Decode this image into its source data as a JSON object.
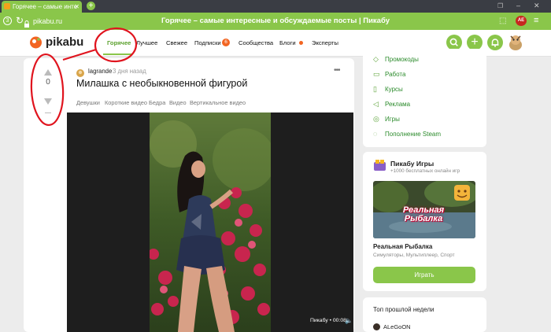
{
  "browser": {
    "tab_title": "Горячее – самые инте",
    "url": "pikabu.ru",
    "window_title": "Горячее – самые интересные и обсуждаемые посты | Пикабу",
    "account_badge": "AE"
  },
  "header": {
    "logo_text": "pikabu",
    "nav": [
      {
        "label": "Горячее"
      },
      {
        "label": "Лучшее"
      },
      {
        "label": "Свежее"
      },
      {
        "label": "Подписки"
      },
      {
        "label": "Сообщества"
      },
      {
        "label": "Блоги"
      },
      {
        "label": "Эксперты"
      }
    ],
    "subscriptions_count": "6"
  },
  "post": {
    "rating": "0",
    "author": "lagrande",
    "time": "3 дня назад",
    "title": "Милашка с необыкновенной фигурой",
    "tags": [
      "Девушки",
      "Короткие видео",
      "Бедра",
      "Видео",
      "Вертикальное видео"
    ],
    "video_caption": "Пикабу • 00:08"
  },
  "sidebar": {
    "links": [
      {
        "label": "Промокоды",
        "icon": "tag-icon"
      },
      {
        "label": "Работа",
        "icon": "briefcase-icon"
      },
      {
        "label": "Курсы",
        "icon": "book-icon"
      },
      {
        "label": "Реклама",
        "icon": "megaphone-icon"
      },
      {
        "label": "Игры",
        "icon": "gamepad-icon"
      },
      {
        "label": "Пополнение Steam",
        "icon": "steam-icon"
      }
    ],
    "games": {
      "title": "Пикабу Игры",
      "subtitle": "+1000 бесплатных онлайн игр",
      "game_banner_text": "Реальная Рыбалка",
      "game_name": "Реальная Рыбалка",
      "game_genres": "Симуляторы, Мультиплеер, Спорт",
      "play_label": "Играть"
    },
    "top_week": {
      "title": "Топ прошлой недели",
      "first_user": "ALeGoON"
    }
  },
  "colors": {
    "brand_green": "#8ac64a",
    "accent_orange": "#f26522",
    "annotation_red": "#e0141e"
  }
}
